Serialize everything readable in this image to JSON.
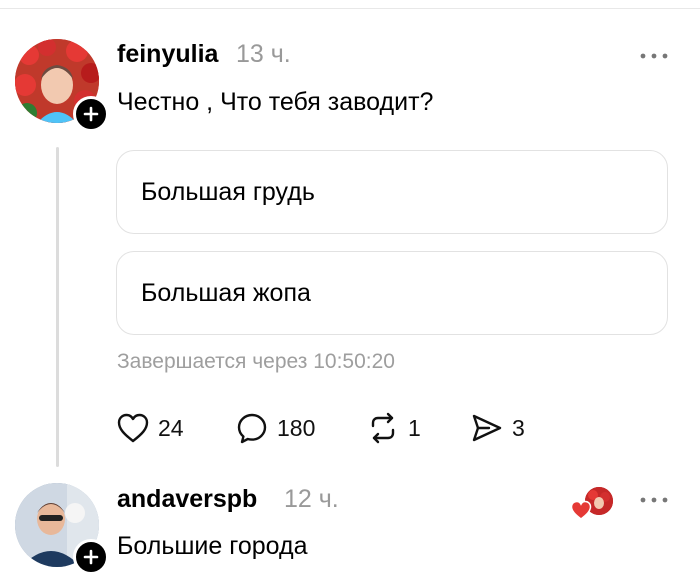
{
  "post1": {
    "username": "feinyulia",
    "time": "13 ч.",
    "text": "Честно , Что тебя заводит?",
    "poll": {
      "options": [
        "Большая грудь",
        "Большая жопа"
      ],
      "status": "Завершается через 10:50:20"
    },
    "actions": {
      "likes": "24",
      "comments": "180",
      "reposts": "1",
      "shares": "3"
    }
  },
  "post2": {
    "username": "andaverspb",
    "time": "12 ч.",
    "text": "Большие города"
  },
  "icons": {
    "like": "heart-outline-icon",
    "comment": "speech-bubble-icon",
    "repost": "repost-arrows-icon",
    "share": "paper-plane-icon",
    "more": "ellipsis-icon",
    "follow": "plus-icon"
  },
  "colors": {
    "muted_text": "#999999",
    "border": "#e2e2e2",
    "thread_line": "#dcdcdc",
    "liked_heart": "#e53935"
  }
}
